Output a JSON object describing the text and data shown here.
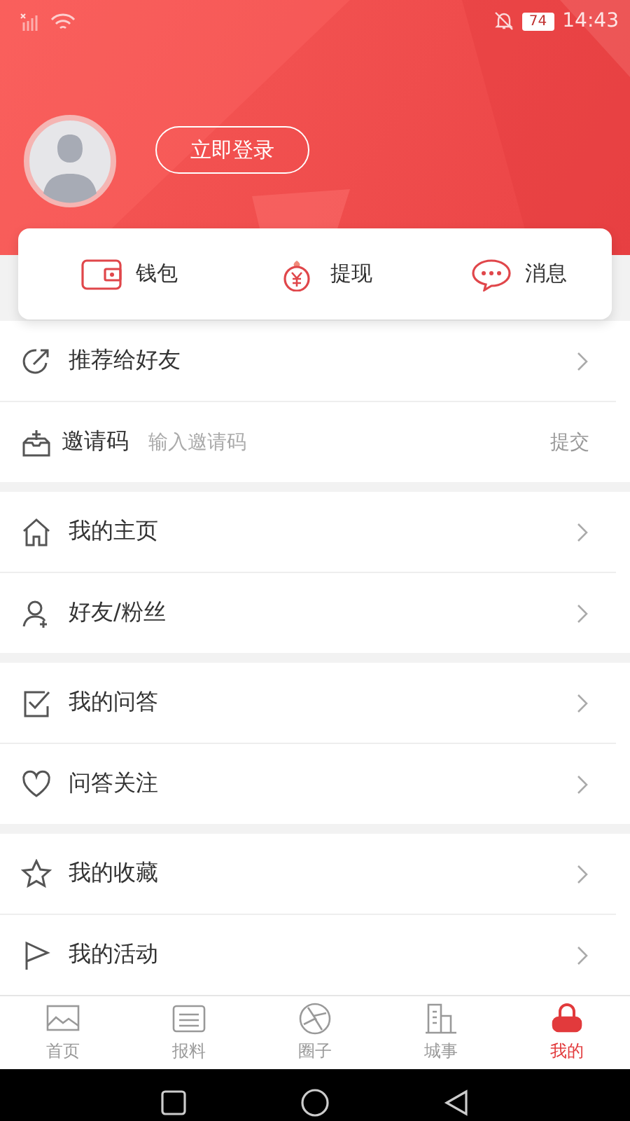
{
  "status_bar": {
    "battery": "74",
    "time": "14:43"
  },
  "login_button": "立即登录",
  "quick_actions": [
    {
      "label": "钱包"
    },
    {
      "label": "提现"
    },
    {
      "label": "消息"
    }
  ],
  "sections": [
    {
      "rows": [
        {
          "kind": "link",
          "label": "推荐给好友"
        },
        {
          "kind": "invite",
          "label": "邀请码",
          "placeholder": "输入邀请码",
          "action": "提交"
        }
      ]
    },
    {
      "rows": [
        {
          "kind": "link",
          "label": "我的主页"
        },
        {
          "kind": "link",
          "label": "好友/粉丝"
        }
      ]
    },
    {
      "rows": [
        {
          "kind": "link",
          "label": "我的问答"
        },
        {
          "kind": "link",
          "label": "问答关注"
        }
      ]
    },
    {
      "rows": [
        {
          "kind": "link",
          "label": "我的收藏"
        },
        {
          "kind": "link",
          "label": "我的活动"
        }
      ]
    }
  ],
  "tabs": [
    {
      "label": "首页",
      "selected": false
    },
    {
      "label": "报料",
      "selected": false
    },
    {
      "label": "圈子",
      "selected": false
    },
    {
      "label": "城事",
      "selected": false
    },
    {
      "label": "我的",
      "selected": true
    }
  ]
}
